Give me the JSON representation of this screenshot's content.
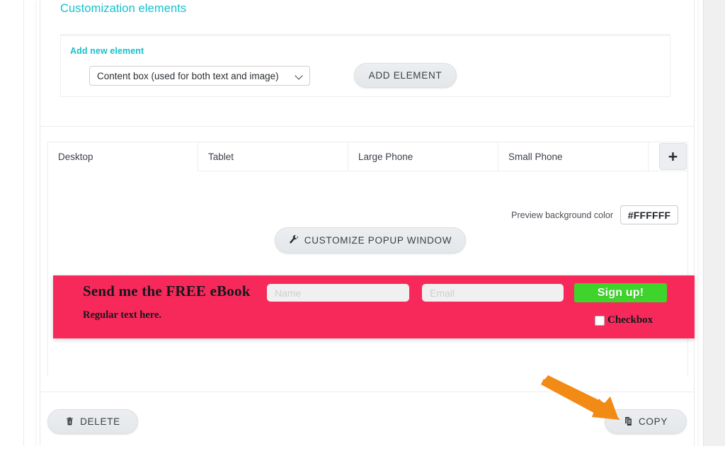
{
  "section_customization": {
    "title": "Customization elements",
    "panel": {
      "label": "Add new element",
      "select_value": "Content box (used for both text and image)",
      "select_options": [
        "Content box (used for both text and image)"
      ],
      "chevron_icon": "chevron-down-icon",
      "add_button_label": "ADD ELEMENT"
    }
  },
  "section_preview": {
    "tabs": [
      {
        "label": "Desktop",
        "active": true
      },
      {
        "label": "Tablet",
        "active": false
      },
      {
        "label": "Large Phone",
        "active": false
      },
      {
        "label": "Small Phone",
        "active": false
      }
    ],
    "add_tab_icon": "plus-icon",
    "add_tab_label": "+",
    "background_color": {
      "label": "Preview background color",
      "value": "#FFFFFF"
    },
    "customize_button": {
      "icon": "wrench-icon",
      "icon_glyph": "🔧",
      "label": "CUSTOMIZE POPUP WINDOW"
    }
  },
  "optin_banner": {
    "background_color": "#F7295B",
    "headline": "Send me the FREE eBook",
    "subtext": "Regular text here.",
    "name_field": {
      "value": "",
      "placeholder": "Name"
    },
    "email_field": {
      "value": "",
      "placeholder": "Email"
    },
    "signup_button": {
      "label": "Sign up!",
      "color": "#3ED42B"
    },
    "checkbox": {
      "label": "Checkbox",
      "checked": false
    }
  },
  "footer_actions": {
    "delete_button": {
      "icon": "trash-icon",
      "icon_glyph": "🗑",
      "label": "DELETE"
    },
    "copy_button": {
      "icon": "copy-icon",
      "icon_glyph": "📑",
      "label": "COPY"
    }
  },
  "annotation": {
    "arrow_color": "#F28A16",
    "arrow_points_to": "copy-button"
  }
}
